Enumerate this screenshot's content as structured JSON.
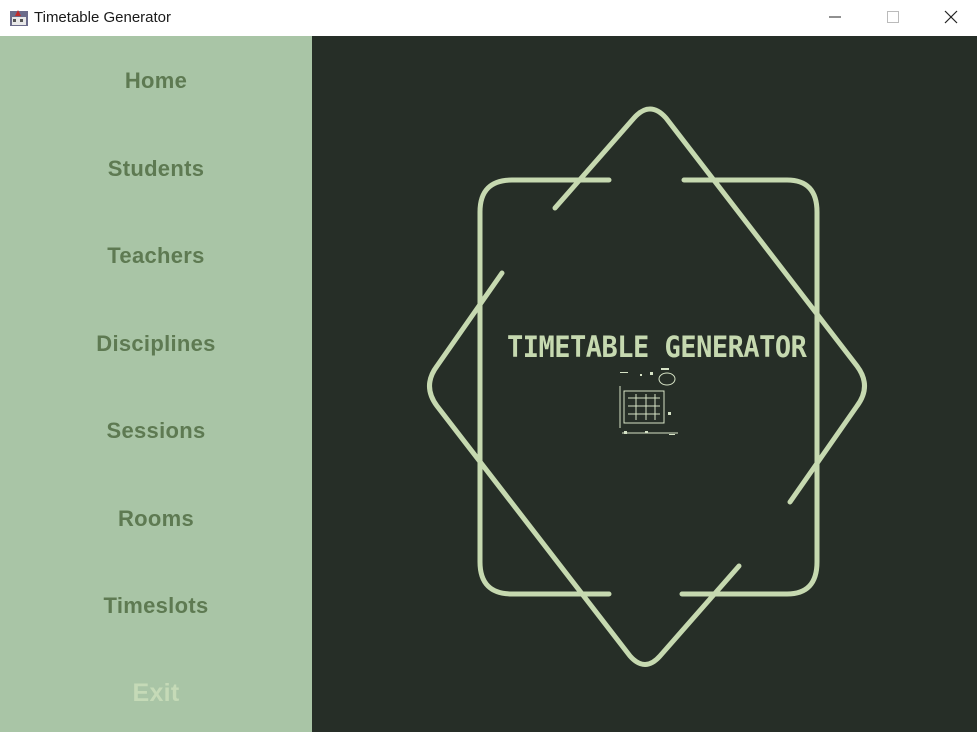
{
  "window": {
    "title": "Timetable Generator"
  },
  "sidebar": {
    "items": [
      {
        "label": "Home"
      },
      {
        "label": "Students"
      },
      {
        "label": "Teachers"
      },
      {
        "label": "Disciplines"
      },
      {
        "label": "Sessions"
      },
      {
        "label": "Rooms"
      },
      {
        "label": "Timeslots"
      }
    ],
    "exit_label": "Exit"
  },
  "main": {
    "logo_title": "TIMETABLE GENERATOR"
  },
  "colors": {
    "sidebar_bg": "#a9c5a6",
    "sidebar_text": "#5e7a52",
    "exit_text": "#c5dab7",
    "main_bg": "#262e27",
    "logo_stroke": "#c6d9b0"
  }
}
